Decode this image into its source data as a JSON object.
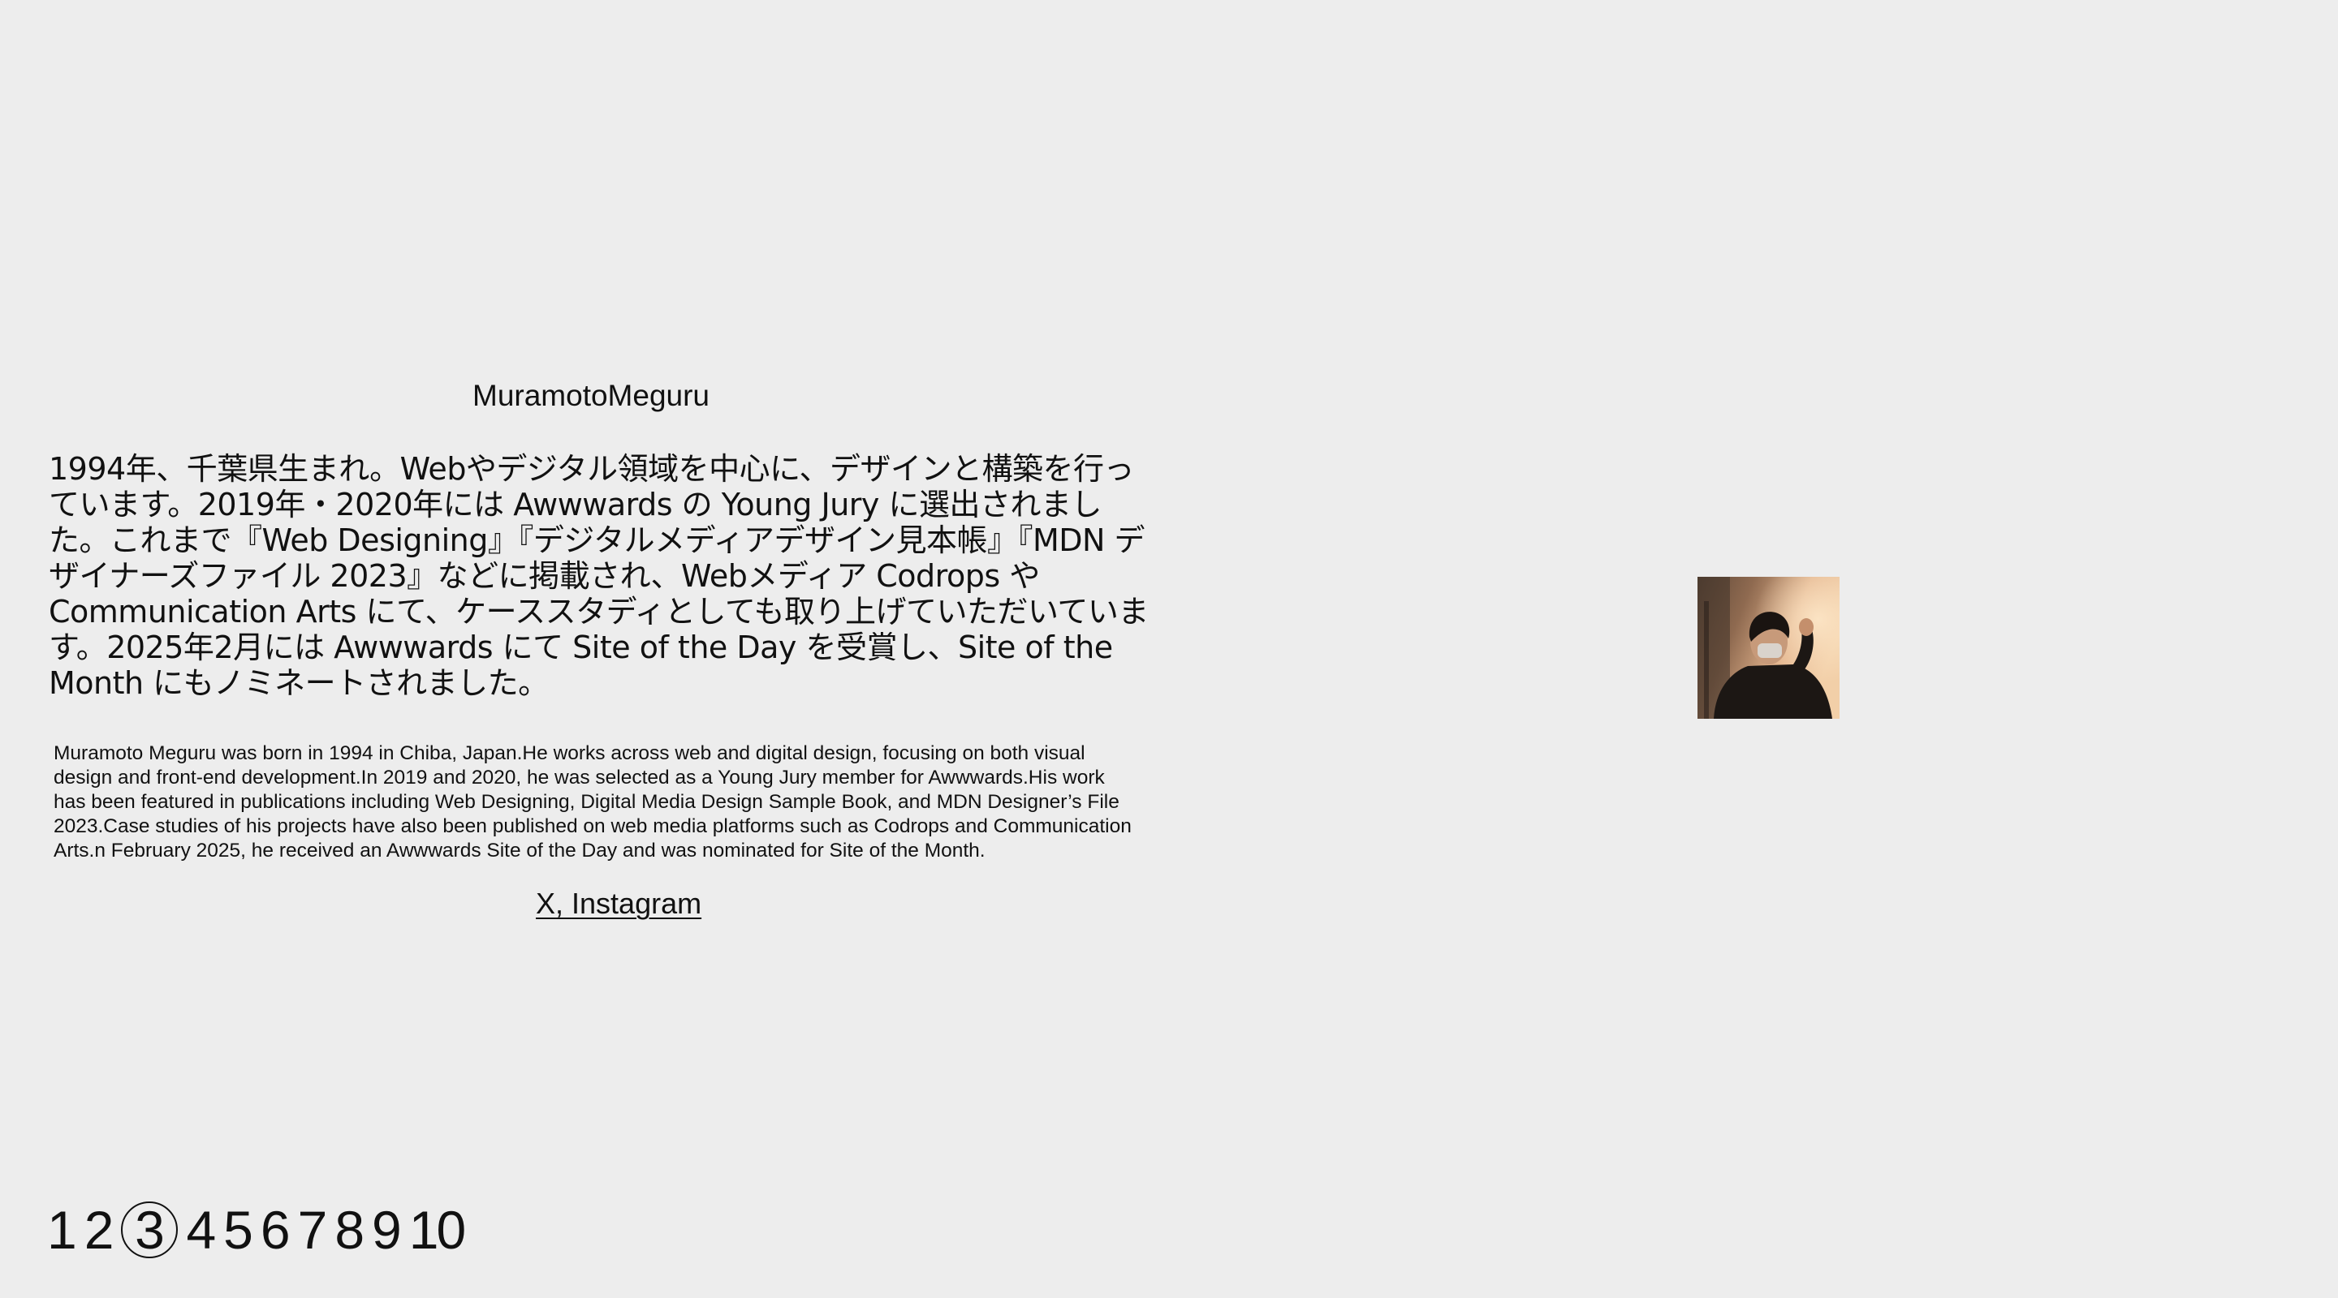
{
  "profile": {
    "name": "MuramotoMeguru",
    "bio_ja": "1994年、千葉県生まれ。Webやデジタル領域を中心に、デザインと構築を行っています。2019年・2020年には Awwwards の Young Jury に選出されました。これまで『Web Designing』『デジタルメディアデザイン見本帳』『MDN デザイナーズファイル 2023』などに掲載され、Webメディア Codrops や Communication Arts にて、ケーススタディとしても取り上げていただいています。2025年2月には Awwwards にて Site of the Day を受賞し、Site of the Month にもノミネートされました。",
    "bio_en": "Muramoto Meguru was born in 1994 in Chiba, Japan.He works across web and digital design, focusing on both visual design and front-end development.In 2019 and 2020, he was selected as a Young Jury member for Awwwards.His work has been featured in publications including Web Designing, Digital Media Design Sample Book, and MDN Designer’s File 2023.Case studies of his projects have also been published on web media platforms such as Codrops and Communication Arts.n February 2025, he received an Awwwards Site of the Day and was nominated for Site of the Month."
  },
  "links": {
    "x_label": "X",
    "separator": ", ",
    "instagram_label": "Instagram"
  },
  "photo": {
    "icon": "portrait-photo"
  },
  "pagination": {
    "pages": [
      "1",
      "2",
      "3",
      "4",
      "5",
      "6",
      "7",
      "8",
      "9",
      "10"
    ],
    "current": "3"
  }
}
